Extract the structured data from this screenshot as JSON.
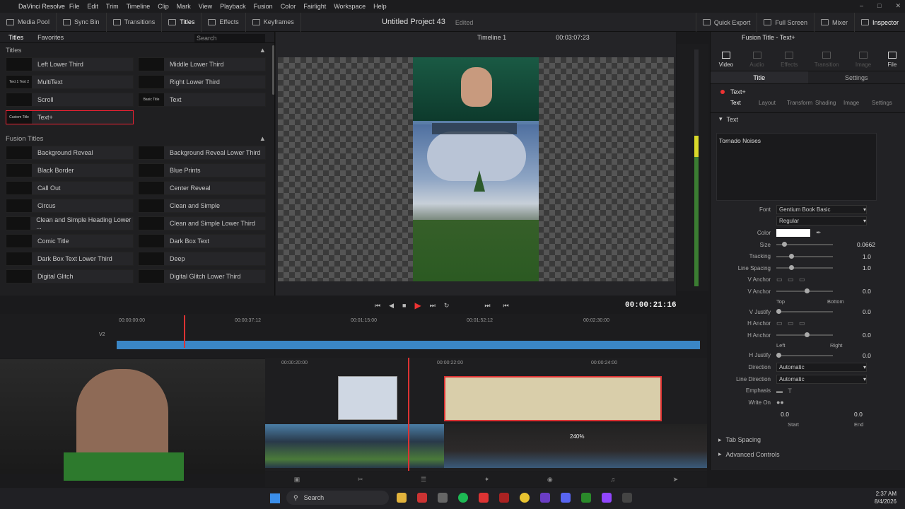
{
  "menubar": {
    "app": "DaVinci Resolve",
    "items": [
      "File",
      "Edit",
      "Trim",
      "Timeline",
      "Clip",
      "Mark",
      "View",
      "Playback",
      "Fusion",
      "Color",
      "Fairlight",
      "Workspace",
      "Help"
    ]
  },
  "toolbar": {
    "media_pool": "Media Pool",
    "sync_bin": "Sync Bin",
    "transitions": "Transitions",
    "titles": "Titles",
    "effects": "Effects",
    "keyframes": "Keyframes",
    "quick_export": "Quick Export",
    "full_screen": "Full Screen",
    "mixer": "Mixer",
    "inspector": "Inspector"
  },
  "project": {
    "title": "Untitled Project 43",
    "status": "Edited"
  },
  "leftpanel": {
    "tab_titles": "Titles",
    "tab_favorites": "Favorites",
    "search_placeholder": "Search",
    "section1": "Titles",
    "titles": [
      "Left Lower Third",
      "Middle Lower Third",
      "MultiText",
      "Right Lower Third",
      "Scroll",
      "Text",
      "Text+"
    ],
    "thumbs": [
      "Text 1 Text 2",
      "Basic Title",
      "Custom Title"
    ],
    "section2": "Fusion Titles",
    "fusion": [
      "Background Reveal",
      "Background Reveal Lower Third",
      "Black Border",
      "Blue Prints",
      "Call Out",
      "Center Reveal",
      "Circus",
      "Clean and Simple",
      "Clean and Simple Heading Lower ...",
      "Clean and Simple Lower Third",
      "Comic Title",
      "Dark Box Text",
      "Dark Box Text Lower Third",
      "Deep",
      "Digital Glitch",
      "Digital Glitch Lower Third"
    ]
  },
  "viewer": {
    "timeline": "Timeline 1",
    "timecode_top": "00:03:07:23",
    "timecode": "00:00:21:16"
  },
  "meter": {
    "ticks": [
      "0",
      "-5",
      "-10",
      "-15",
      "-20",
      "-30",
      "-40",
      "-50"
    ]
  },
  "inspector": {
    "header": "Fusion Title - Text+",
    "tabs": [
      "Video",
      "Audio",
      "Effects",
      "Transition",
      "Image",
      "File"
    ],
    "subtabs": [
      "Title",
      "Settings"
    ],
    "node": "Text+",
    "nodetabs": [
      "Text",
      "Layout",
      "Transform",
      "Shading",
      "Image",
      "Settings"
    ],
    "section": "Text",
    "text_value": "Tornado Noises",
    "font_label": "Font",
    "font": "Gentium Book Basic",
    "style": "Regular",
    "color_label": "Color",
    "size_label": "Size",
    "size": "0.0662",
    "tracking_label": "Tracking",
    "tracking": "1.0",
    "linespacing_label": "Line Spacing",
    "linespacing": "1.0",
    "vanchor_label": "V Anchor",
    "vanchor2_label": "V Anchor",
    "vanchor_val": "0.0",
    "top": "Top",
    "bottom": "Bottom",
    "vjustify_label": "V Justify",
    "vjustify": "0.0",
    "hanchor_label": "H Anchor",
    "hanchor2_label": "H Anchor",
    "hanchor_val": "0.0",
    "left": "Left",
    "right": "Right",
    "hjustify_label": "H Justify",
    "hjustify": "0.0",
    "direction_label": "Direction",
    "direction": "Automatic",
    "linedir_label": "Line Direction",
    "linedir": "Automatic",
    "emphasis_label": "Emphasis",
    "writeon_label": "Write On",
    "start": "0.0",
    "end": "0.0",
    "start_label": "Start",
    "end_label": "End",
    "tabspacing": "Tab Spacing",
    "advanced": "Advanced Controls"
  },
  "timeline": {
    "ruler_top": [
      "00:00:00:00",
      "00:00:37:12",
      "00:01:15:00",
      "00:01:52:12",
      "00:02:30:00"
    ],
    "ruler_bottom": [
      "00:00:20:00",
      "00:00:22:00",
      "00:00:24:00"
    ],
    "track_v2": "V2",
    "zoom": "240%"
  },
  "taskbar": {
    "search": "Search",
    "time": "2:37 AM",
    "date": "8/4/2026"
  }
}
